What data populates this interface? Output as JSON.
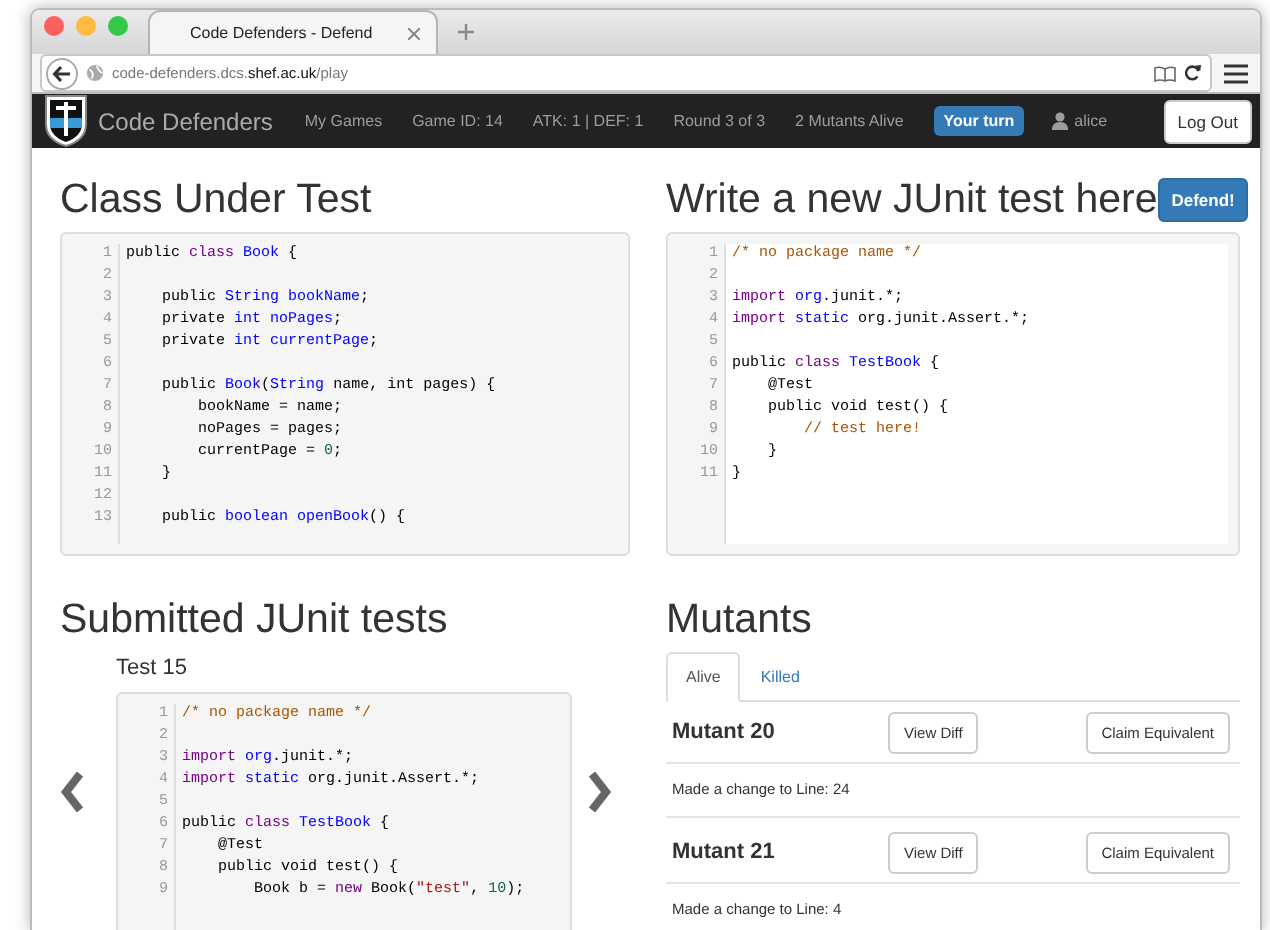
{
  "browser": {
    "tab_title": "Code Defenders - Defend",
    "url": "code-defenders.dcs.**shef.ac.uk**/play"
  },
  "navbar": {
    "brand": "Code Defenders",
    "items": [
      "My Games",
      "Game ID: 14",
      "ATK: 1 | DEF: 1",
      "Round 3 of 3",
      "2 Mutants Alive"
    ],
    "badge": "Your turn",
    "user": "alice",
    "logout": "Log Out"
  },
  "class_under_test": {
    "title": "Class Under Test",
    "lines": [
      {
        "number": "1",
        "segments": [
          {
            "kind": "plain",
            "text": "public "
          },
          {
            "kind": "keyword",
            "text": "class"
          },
          {
            "kind": "def",
            "text": " Book"
          },
          {
            "kind": "plain",
            "text": " {"
          }
        ]
      },
      {
        "number": "2"
      },
      {
        "number": "3",
        "segments": [
          {
            "kind": "plain",
            "text": "    public "
          },
          {
            "kind": "def",
            "text": "String bookName"
          },
          {
            "kind": "plain",
            "text": ";"
          }
        ]
      },
      {
        "number": "4",
        "segments": [
          {
            "kind": "plain",
            "text": "    private "
          },
          {
            "kind": "def",
            "text": "int noPages"
          },
          {
            "kind": "plain",
            "text": ";"
          }
        ]
      },
      {
        "number": "5",
        "segments": [
          {
            "kind": "plain",
            "text": "    private "
          },
          {
            "kind": "def",
            "text": "int currentPage"
          },
          {
            "kind": "plain",
            "text": ";"
          }
        ]
      },
      {
        "number": "6"
      },
      {
        "number": "7",
        "segments": [
          {
            "kind": "plain",
            "text": "    public "
          },
          {
            "kind": "def",
            "text": "Book"
          },
          {
            "kind": "plain",
            "text": "("
          },
          {
            "kind": "def",
            "text": "String"
          },
          {
            "kind": "plain",
            "text": " name, int pages) {"
          }
        ]
      },
      {
        "number": "8",
        "segments": [
          {
            "kind": "plain",
            "text": "        bookName = name;"
          }
        ]
      },
      {
        "number": "9",
        "segments": [
          {
            "kind": "plain",
            "text": "        noPages = pages;"
          }
        ]
      },
      {
        "number": "10",
        "segments": [
          {
            "kind": "plain",
            "text": "        currentPage = "
          },
          {
            "kind": "number",
            "text": "0"
          },
          {
            "kind": "plain",
            "text": ";"
          }
        ]
      },
      {
        "number": "11",
        "segments": [
          {
            "kind": "plain",
            "text": "    }"
          }
        ]
      },
      {
        "number": "12"
      },
      {
        "number": "13",
        "segments": [
          {
            "kind": "plain",
            "text": "    public "
          },
          {
            "kind": "def",
            "text": "boolean openBook"
          },
          {
            "kind": "plain",
            "text": "() {"
          }
        ]
      }
    ]
  },
  "new_test": {
    "title": "Write a new JUnit test here",
    "button": "Defend!",
    "lines": [
      {
        "number": "1",
        "segments": [
          {
            "kind": "comment",
            "text": "/* no package name */"
          }
        ]
      },
      {
        "number": "2"
      },
      {
        "number": "3",
        "segments": [
          {
            "kind": "keyword",
            "text": "import"
          },
          {
            "kind": "def",
            "text": " org"
          },
          {
            "kind": "plain",
            "text": ".junit.*;"
          }
        ]
      },
      {
        "number": "4",
        "segments": [
          {
            "kind": "keyword",
            "text": "import"
          },
          {
            "kind": "def",
            "text": " static"
          },
          {
            "kind": "plain",
            "text": " org.junit.Assert.*;"
          }
        ]
      },
      {
        "number": "5"
      },
      {
        "number": "6",
        "segments": [
          {
            "kind": "plain",
            "text": "public "
          },
          {
            "kind": "keyword",
            "text": "class"
          },
          {
            "kind": "def",
            "text": " TestBook"
          },
          {
            "kind": "plain",
            "text": " {"
          }
        ]
      },
      {
        "number": "7",
        "segments": [
          {
            "kind": "plain",
            "text": "    @Test"
          }
        ]
      },
      {
        "number": "8",
        "segments": [
          {
            "kind": "plain",
            "text": "    public void test() {"
          }
        ]
      },
      {
        "number": "9",
        "segments": [
          {
            "kind": "comment",
            "text": "        // test here!"
          }
        ]
      },
      {
        "number": "10",
        "segments": [
          {
            "kind": "plain",
            "text": "    }"
          }
        ]
      },
      {
        "number": "11",
        "segments": [
          {
            "kind": "plain",
            "text": "}"
          }
        ]
      }
    ]
  },
  "submitted_tests": {
    "title": "Submitted JUnit tests",
    "test_title": "Test 15",
    "lines": [
      {
        "number": "1",
        "segments": [
          {
            "kind": "comment",
            "text": "/* no package name */"
          }
        ]
      },
      {
        "number": "2"
      },
      {
        "number": "3",
        "segments": [
          {
            "kind": "keyword",
            "text": "import"
          },
          {
            "kind": "def",
            "text": " org"
          },
          {
            "kind": "plain",
            "text": ".junit.*;"
          }
        ]
      },
      {
        "number": "4",
        "segments": [
          {
            "kind": "keyword",
            "text": "import"
          },
          {
            "kind": "def",
            "text": " static"
          },
          {
            "kind": "plain",
            "text": " org.junit.Assert.*;"
          }
        ]
      },
      {
        "number": "5"
      },
      {
        "number": "6",
        "segments": [
          {
            "kind": "plain",
            "text": "public "
          },
          {
            "kind": "keyword",
            "text": "class"
          },
          {
            "kind": "def",
            "text": " TestBook"
          },
          {
            "kind": "plain",
            "text": " {"
          }
        ]
      },
      {
        "number": "7",
        "segments": [
          {
            "kind": "plain",
            "text": "    @Test"
          }
        ]
      },
      {
        "number": "8",
        "segments": [
          {
            "kind": "plain",
            "text": "    public void test() {"
          }
        ]
      },
      {
        "number": "9",
        "segments": [
          {
            "kind": "plain",
            "text": "        Book b = "
          },
          {
            "kind": "keyword",
            "text": "new"
          },
          {
            "kind": "plain",
            "text": " Book("
          },
          {
            "kind": "string",
            "text": "\"test\""
          },
          {
            "kind": "plain",
            "text": ", "
          },
          {
            "kind": "number",
            "text": "10"
          },
          {
            "kind": "plain",
            "text": ");"
          }
        ]
      }
    ]
  },
  "mutants": {
    "title": "Mutants",
    "tabs": [
      {
        "label": "Alive",
        "selected": true
      },
      {
        "label": "Killed",
        "selected": false
      }
    ],
    "items": [
      {
        "name": "Mutant 20",
        "view_button": "View Diff",
        "claim_button": "Claim Equivalent",
        "description": "Made a change to Line: 24"
      },
      {
        "name": "Mutant 21",
        "view_button": "View Diff",
        "claim_button": "Claim Equivalent",
        "description": "Made a change to Line: 4"
      }
    ]
  }
}
